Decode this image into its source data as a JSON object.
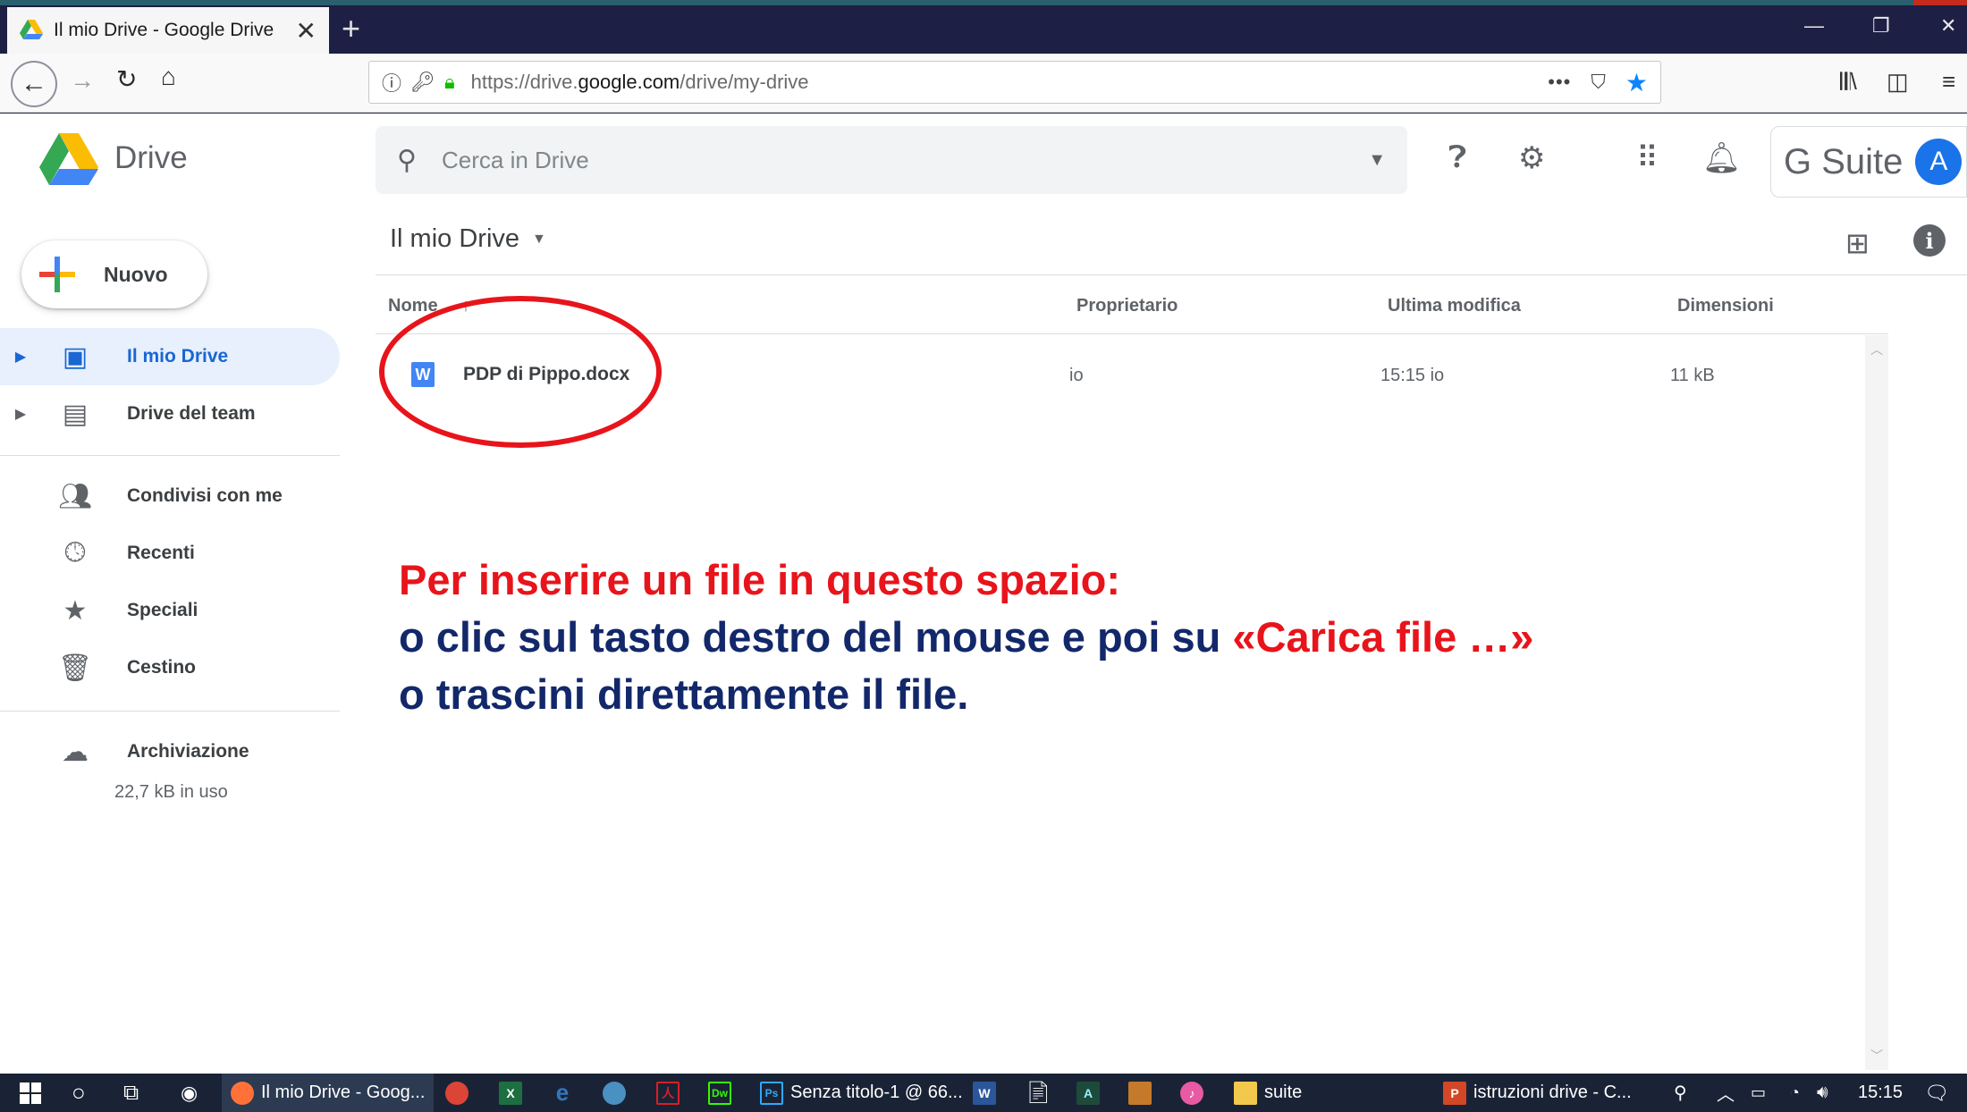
{
  "browser": {
    "tab_title": "Il mio Drive - Google Drive",
    "tab_close": "✕",
    "new_tab": "+",
    "url_prefix": "https://drive.",
    "url_domain": "google.com",
    "url_path": "/drive/my-drive",
    "dots": "•••"
  },
  "drive": {
    "app_name": "Drive",
    "search_placeholder": "Cerca in Drive",
    "gsuite_label": "G Suite",
    "avatar_letter": "A",
    "new_button": "Nuovo",
    "breadcrumb": "Il mio Drive",
    "sidebar": {
      "items": [
        {
          "label": "Il mio Drive",
          "icon": "my-drive-icon",
          "active": true
        },
        {
          "label": "Drive del team",
          "icon": "team-drive-icon"
        },
        {
          "label": "Condivisi con me",
          "icon": "people-icon"
        },
        {
          "label": "Recenti",
          "icon": "clock-icon"
        },
        {
          "label": "Speciali",
          "icon": "star-icon"
        },
        {
          "label": "Cestino",
          "icon": "trash-icon"
        },
        {
          "label": "Archiviazione",
          "icon": "cloud-icon"
        }
      ],
      "storage_used": "22,7 kB in uso"
    },
    "table": {
      "columns": [
        "Nome",
        "Proprietario",
        "Ultima modifica",
        "Dimensioni"
      ],
      "rows": [
        {
          "name": "PDP di Pippo.docx",
          "owner": "io",
          "modified": "15:15 io",
          "size": "11 kB",
          "icon_letter": "W"
        }
      ]
    }
  },
  "overlay": {
    "line1": "Per inserire un file in questo spazio:",
    "line2_a": "o clic sul tasto destro del mouse  e poi su ",
    "line2_b": "«Carica file …»",
    "line3": "o trascini direttamente il file.",
    "colors": {
      "red": "#e8141b",
      "navy": "#12286a"
    }
  },
  "taskbar": {
    "firefox_item": "Il mio Drive - Goog...",
    "ps_item": "Senza titolo-1 @ 66...",
    "folder_item": "suite",
    "ppt_item": "istruzioni drive - C...",
    "clock": "15:15"
  }
}
